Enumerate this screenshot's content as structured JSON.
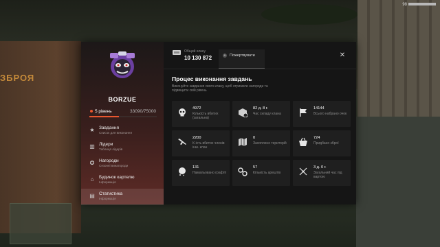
{
  "background": {
    "sign_text": "ЗБРОЯ",
    "hud_topright": "98"
  },
  "profile": {
    "username": "BORZUE",
    "level": "5 рівень",
    "xp": "33090/75000",
    "xp_progress": 0.44
  },
  "nav": {
    "items": [
      {
        "title": "Завдання",
        "subtitle": "Список для виконання",
        "icon": "star-icon"
      },
      {
        "title": "Лідери",
        "subtitle": "Таблиця лідерів",
        "icon": "leaderboard-icon"
      },
      {
        "title": "Нагороди",
        "subtitle": "Сезонні винагороди",
        "icon": "gift-icon"
      },
      {
        "title": "Будинок картелю",
        "subtitle": "Інформація",
        "icon": "house-icon"
      },
      {
        "title": "Статистика",
        "subtitle": "Інформація",
        "icon": "chart-icon"
      }
    ]
  },
  "header": {
    "balance_label": "Общий клану",
    "balance_value": "10 130 872",
    "donate_label": "Пожертвувати"
  },
  "content": {
    "title": "Процес виконання завдань",
    "subtitle": "Виконуйте завдання свого клану, щоб отримати нагороди та підвищити свій рівень"
  },
  "stats": [
    {
      "value": "4972",
      "label": "Кількість вбитих (загальна)",
      "icon": "skull-icon"
    },
    {
      "value": "82 д. 8 г.",
      "label": "Час складу клана",
      "icon": "box-clock-icon"
    },
    {
      "value": "14144",
      "label": "Всього набрано очок",
      "icon": "flag-icon"
    },
    {
      "value": "2200",
      "label": "К-ість вбитих членів інш. клан",
      "icon": "rifle-icon"
    },
    {
      "value": "0",
      "label": "Захоплено територій",
      "icon": "map-icon"
    },
    {
      "value": "724",
      "label": "Придбано зброї",
      "icon": "basket-icon"
    },
    {
      "value": "131",
      "label": "Намальовано графіті",
      "icon": "spray-icon"
    },
    {
      "value": "57",
      "label": "Кількість арештів",
      "icon": "handcuffs-icon"
    },
    {
      "value": "3 д. 0 г.",
      "label": "Загальний час під вартою",
      "icon": "sparkle-icon"
    }
  ]
}
